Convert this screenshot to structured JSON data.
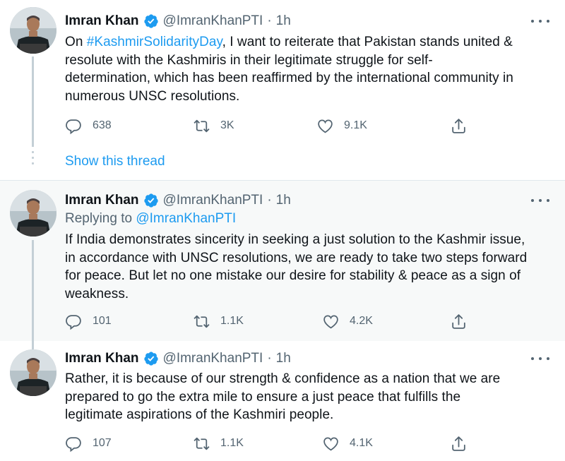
{
  "tweets": [
    {
      "author": "Imran Khan",
      "handle": "@ImranKhanPTI",
      "separator": "·",
      "time": "1h",
      "lines": [
        {
          "pre": "On ",
          "tag": "#KashmirSolidarityDay",
          "post": ", I want to reiterate that Pakistan stands united &"
        },
        {
          "text": "resolute with the Kashmiris in their legitimate struggle for self-"
        },
        {
          "text": "determination, which has been reaffirmed by the international community in"
        },
        {
          "text": "numerous UNSC resolutions."
        }
      ],
      "replies": "638",
      "retweets": "3K",
      "likes": "9.1K",
      "show_thread": "Show this thread"
    },
    {
      "author": "Imran Khan",
      "handle": "@ImranKhanPTI",
      "separator": "·",
      "time": "1h",
      "replying_prefix": "Replying to ",
      "replying_to": "@ImranKhanPTI",
      "lines": [
        {
          "text": "If India demonstrates sincerity in seeking a just solution to the Kashmir issue,"
        },
        {
          "text": "in accordance with UNSC resolutions, we are ready to take two steps forward"
        },
        {
          "text": "for peace. But let no one mistake our desire for stability & peace as a sign of"
        },
        {
          "text": "weakness."
        }
      ],
      "replies": "101",
      "retweets": "1.1K",
      "likes": "4.2K"
    },
    {
      "author": "Imran Khan",
      "handle": "@ImranKhanPTI",
      "separator": "·",
      "time": "1h",
      "lines": [
        {
          "text": "Rather, it is because of our strength & confidence as a nation that we are"
        },
        {
          "text": "prepared to go the extra mile to ensure a just peace that fulfills the"
        },
        {
          "text": "legitimate aspirations of the Kashmiri people."
        }
      ],
      "replies": "107",
      "retweets": "1.1K",
      "likes": "4.1K"
    }
  ],
  "icons": {
    "verified": "verified-badge-icon",
    "more": "more-options-icon",
    "reply": "reply-icon",
    "retweet": "retweet-icon",
    "like": "like-icon",
    "share": "share-icon"
  },
  "colors": {
    "link": "#1d9bf0",
    "secondary_text": "#536471",
    "highlight_bg": "#f7f9f9"
  }
}
